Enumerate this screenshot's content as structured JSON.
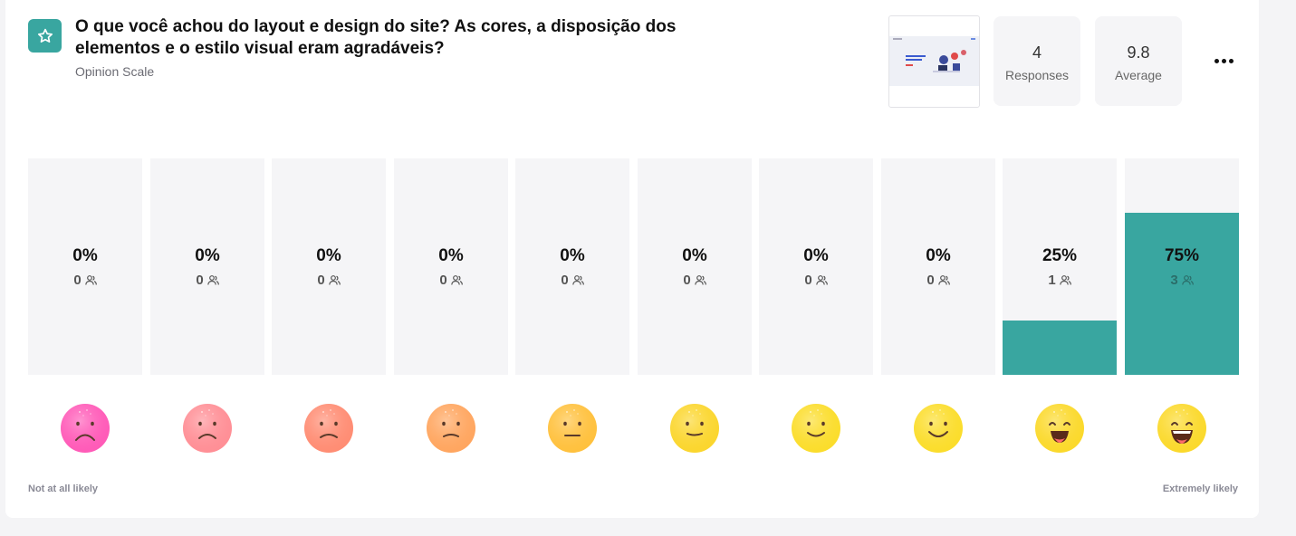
{
  "question": {
    "title": "O que você achou do layout e design do site? As cores, a disposição dos elementos e o estilo visual eram agradáveis?",
    "type": "Opinion Scale",
    "icon": "star-icon",
    "accent": "#39a6a0"
  },
  "stats": {
    "responses": {
      "value": "4",
      "label": "Responses"
    },
    "average": {
      "value": "9.8",
      "label": "Average"
    }
  },
  "scale": {
    "low_label": "Not at all likely",
    "high_label": "Extremely likely",
    "options": [
      {
        "percent": "0%",
        "count": "0",
        "fraction": 0,
        "face": "very-sad-face-icon",
        "color": "#ff5bb8"
      },
      {
        "percent": "0%",
        "count": "0",
        "fraction": 0,
        "face": "sad-face-icon",
        "color": "#ff8f96"
      },
      {
        "percent": "0%",
        "count": "0",
        "fraction": 0,
        "face": "sad-face-icon",
        "color": "#ff8d74"
      },
      {
        "percent": "0%",
        "count": "0",
        "fraction": 0,
        "face": "slightly-sad-face-icon",
        "color": "#ffa660"
      },
      {
        "percent": "0%",
        "count": "0",
        "fraction": 0,
        "face": "neutral-face-icon",
        "color": "#ffc13e"
      },
      {
        "percent": "0%",
        "count": "0",
        "fraction": 0,
        "face": "slight-smile-face-icon",
        "color": "#fbd62e"
      },
      {
        "percent": "0%",
        "count": "0",
        "fraction": 0,
        "face": "smile-face-icon",
        "color": "#fbdd2c"
      },
      {
        "percent": "0%",
        "count": "0",
        "fraction": 0,
        "face": "happy-face-icon",
        "color": "#fbdd2c"
      },
      {
        "percent": "25%",
        "count": "1",
        "fraction": 0.25,
        "face": "grin-face-icon",
        "color": "#fbd92c"
      },
      {
        "percent": "75%",
        "count": "3",
        "fraction": 0.75,
        "face": "beaming-face-icon",
        "color": "#fbd92c"
      }
    ]
  }
}
